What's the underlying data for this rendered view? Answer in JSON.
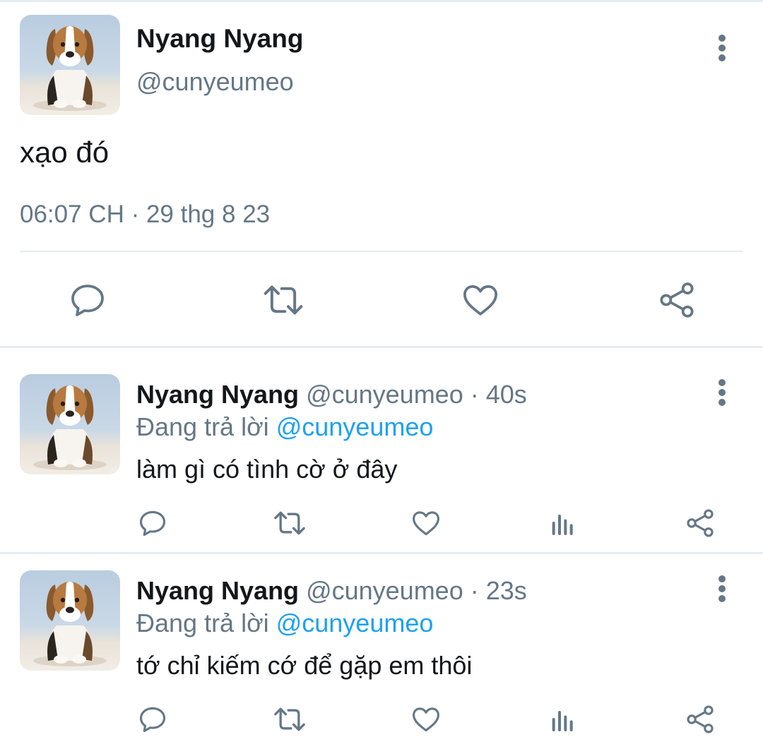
{
  "main_tweet": {
    "author_name": "Nyang Nyang",
    "author_handle": "@cunyeumeo",
    "text": "xạo đó",
    "timestamp": "06:07 CH · 29 thg 8 23",
    "actions": [
      "reply-icon",
      "retweet-icon",
      "like-icon",
      "share-icon"
    ]
  },
  "replies": [
    {
      "author_name": "Nyang Nyang",
      "author_handle": "@cunyeumeo",
      "time": "· 40s",
      "replying_label": "Đang trả lời",
      "replying_to": "@cunyeumeo",
      "text": "làm gì có tình cờ ở đây"
    },
    {
      "author_name": "Nyang Nyang",
      "author_handle": "@cunyeumeo",
      "time": "· 23s",
      "replying_label": "Đang trả lời",
      "replying_to": "@cunyeumeo",
      "text": "tớ chỉ kiếm cớ để gặp em thôi"
    }
  ],
  "colors": {
    "text": "#14171a",
    "secondary": "#657786",
    "mention": "#1da1f2",
    "divider": "#e6ecf0"
  }
}
